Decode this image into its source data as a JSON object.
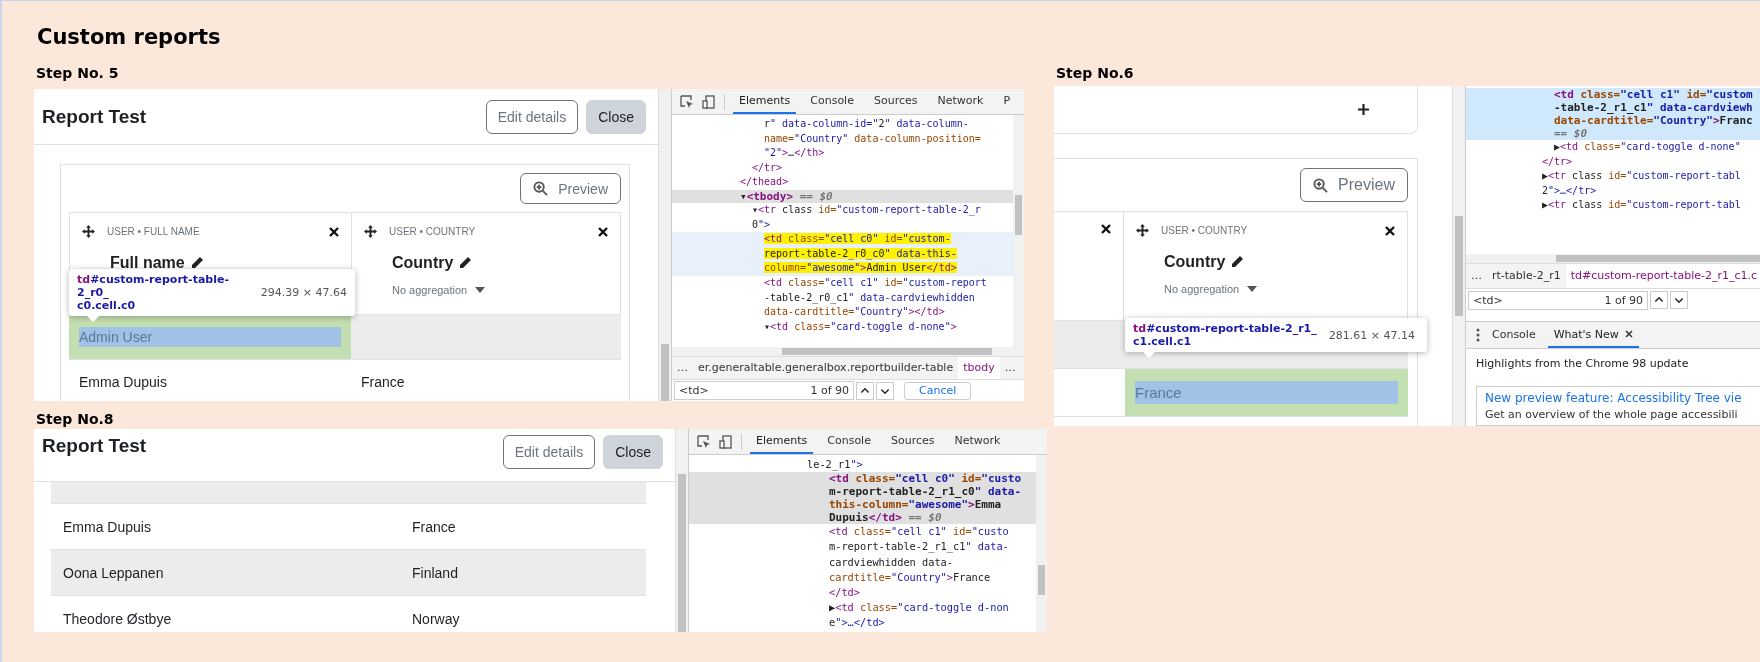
{
  "title": "Custom reports",
  "step5": {
    "label": "Step No. 5",
    "app": {
      "title": "Report Test",
      "buttons": [
        {
          "label": "Edit details",
          "kind": "outline"
        },
        {
          "label": "Close",
          "kind": "secondary"
        }
      ],
      "preview": "Preview",
      "columns": [
        {
          "kind": "full",
          "category": "USER • FULL NAME",
          "name": "Full name"
        },
        {
          "kind": "full",
          "category": "USER • COUNTRY",
          "name": "Country",
          "aggregation": "No aggregation"
        }
      ],
      "rows": [
        {
          "striped": true,
          "cells": [
            {
              "text": "Admin User",
              "inspected": true
            },
            {
              "inspected": false
            }
          ]
        },
        {
          "striped": false,
          "cells": [
            {
              "text": "Emma Dupuis",
              "inspected": false
            },
            {
              "text": "France",
              "inspected": false
            }
          ]
        }
      ],
      "tooltip": {
        "selector": [
          "td#custom-report-table-2_r0_",
          "c0.cell.c0"
        ],
        "size": "294.39 × 47.64"
      }
    },
    "devtools": {
      "focused": false,
      "tabs": [
        {
          "label": "Elements",
          "selected": true
        },
        {
          "label": "Console",
          "selected": false
        },
        {
          "label": "Sources",
          "selected": false
        },
        {
          "label": "Network",
          "selected": false
        },
        {
          "label": "P",
          "selected": false
        }
      ],
      "code": [
        {
          "children": [
            {
              "children": [
                {
                  "selected": false,
                  "lines": [
                    "r\" data-column-id=\"2\" data-column-",
                    "name=\"Country\" data-column-position=",
                    "\"2\">…</th>"
                  ]
                }
              ],
              "close": "</tr>"
            }
          ],
          "close": "</thead>"
        },
        {
          "selected": true,
          "lines": [
            "▾<tbody> == $0"
          ],
          "children": [
            {
              "selected": false,
              "lines": [
                "▾<tr class id=\"custom-report-table-2_r",
                "0\">"
              ],
              "children": [
                {
                  "selected": false,
                  "hovered": true,
                  "lines": [
                    "<td class=\"cell c0\" id=\"custom-",
                    "report-table-2_r0_c0\" data-this-",
                    "column=\"awesome\">Admin User</td>"
                  ]
                },
                {
                  "selected": false,
                  "lines": [
                    "<td class=\"cell c1\" id=\"custom-report",
                    "-table-2_r0_c1\" data-cardviewhidden",
                    "data-cardtitle=\"Country\"></td>"
                  ]
                },
                {
                  "selected": false,
                  "lines": [
                    "▾<td class=\"card-toggle d-none\">"
                  ]
                }
              ]
            }
          ]
        }
      ],
      "breadcrumbs": [
        {
          "label": "…",
          "selected": false
        },
        {
          "label": "er.generaltable.generalbox.reportbuilder-table",
          "selected": false
        },
        {
          "label": "tbody",
          "selected": true
        },
        {
          "label": "…",
          "selected": false
        }
      ],
      "search": {
        "value": "<td>",
        "count": "1 of 90",
        "cancel": "Cancel"
      }
    }
  },
  "step8": {
    "label": "Step No.8",
    "app": {
      "title": "Report Test",
      "buttons": [
        {
          "label": "Edit details",
          "kind": "outline"
        },
        {
          "label": "Close",
          "kind": "secondary"
        }
      ],
      "rows": [
        {
          "striped": true
        },
        {
          "striped": false,
          "cells": [
            {
              "text": "Emma Dupuis",
              "inspected": false
            },
            {
              "text": "France",
              "inspected": false
            }
          ]
        },
        {
          "striped": true,
          "cells": [
            {
              "text": "Oona Leppanen",
              "inspected": false
            },
            {
              "text": "Finland",
              "inspected": false
            }
          ]
        },
        {
          "striped": false,
          "cells": [
            {
              "text": "Theodore Østbye",
              "inspected": false
            },
            {
              "text": "Norway",
              "inspected": false
            }
          ]
        }
      ]
    },
    "devtools": {
      "focused": false,
      "tabs": [
        {
          "label": "Elements",
          "selected": true
        },
        {
          "label": "Console",
          "selected": false
        },
        {
          "label": "Sources",
          "selected": false
        },
        {
          "label": "Network",
          "selected": false
        }
      ],
      "code": [
        {
          "selected": false,
          "lines": [
            "le-2_r1\">"
          ],
          "children": [
            {
              "selected": true,
              "lines": [
                "<td class=\"cell c0\" id=\"custo",
                "m-report-table-2_r1_c0\" data-",
                "this-column=\"awesome\">Emma",
                "Dupuis</td> == $0"
              ]
            },
            {
              "selected": false,
              "lines": [
                "<td class=\"cell c1\" id=\"custo",
                "m-report-table-2_r1_c1\" data-",
                "cardviewhidden data-",
                "cardtitle=\"Country\">France",
                "</td>"
              ]
            },
            {
              "selected": false,
              "lines": [
                "▶<td class=\"card-toggle d-non",
                "e\">…</td>"
              ]
            }
          ]
        }
      ]
    }
  },
  "step6": {
    "label": "Step No.6",
    "app": {
      "preview": "Preview",
      "columns": [
        {
          "kind": "cut"
        },
        {
          "kind": "full",
          "category": "USER • COUNTRY",
          "name": "Country",
          "aggregation": "No aggregation"
        }
      ],
      "rows": [
        {
          "striped": true
        },
        {
          "striped": false,
          "cells": [
            {
              "inspected": false
            },
            {
              "text": "France",
              "inspected": true
            }
          ]
        }
      ],
      "tooltip": {
        "selector": [
          "td#custom-report-table-2_r1_",
          "c1.cell.c1"
        ],
        "size": "281.61 × 47.14"
      }
    },
    "devtools": {
      "focused": true,
      "code": [
        {
          "children": [
            {
              "selected": true,
              "lines": [
                "<td class=\"cell c1\" id=\"custom",
                "-table-2_r1_c1\" data-cardviewh",
                "data-cardtitle=\"Country\">Franc",
                "== $0"
              ]
            },
            {
              "selected": false,
              "lines": [
                "▶<td class=\"card-toggle d-none\""
              ]
            }
          ],
          "close": "</tr>"
        },
        {
          "selected": false,
          "lines": [
            "▶<tr class id=\"custom-report-tabl",
            "2\">…</tr>"
          ]
        },
        {
          "selected": false,
          "lines": [
            "▶<tr class id=\"custom-report-tabl"
          ]
        }
      ],
      "breadcrumbs": [
        {
          "label": "…",
          "selected": false
        },
        {
          "label": "rt-table-2_r1",
          "selected": false
        },
        {
          "label": "td#custom-report-table-2_r1_c1.c",
          "selected": true
        }
      ],
      "search": {
        "value": "<td>",
        "count": "1 of 90"
      },
      "drawer_tabs": [
        {
          "label": "Console",
          "selected": false
        },
        {
          "label": "What's New",
          "selected": true
        }
      ],
      "heading": "Highlights from the Chrome 98 update",
      "card": {
        "link": "New preview feature: Accessibility Tree vie",
        "text": "Get an overview of the whole page accessibili"
      }
    }
  }
}
